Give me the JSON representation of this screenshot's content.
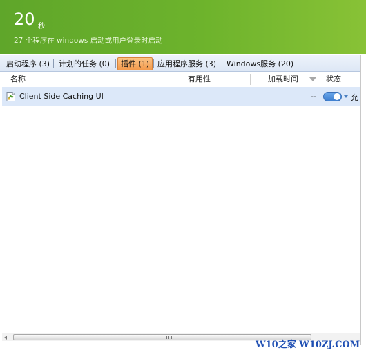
{
  "header": {
    "big_number": "20",
    "unit": "秒",
    "subtitle": "27 个程序在 windows 启动或用户登录时启动"
  },
  "tabs": [
    {
      "label": "启动程序 (3)",
      "active": false
    },
    {
      "label": "计划的任务 (0)",
      "active": false
    },
    {
      "label": "插件 (1)",
      "active": true
    },
    {
      "label": "应用程序服务 (3)",
      "active": false
    },
    {
      "label": "Windows服务 (20)",
      "active": false
    }
  ],
  "columns": {
    "name": "名称",
    "useful": "有用性",
    "load_time": "加载时间",
    "status": "状态"
  },
  "rows": [
    {
      "name": "Client Side Caching UI",
      "useful": "--",
      "status": "允",
      "enabled": true
    }
  ],
  "watermark": "W10之家 W10ZJ.COM",
  "colors": {
    "header_green": "#6db32c",
    "active_tab": "#f39a4c",
    "selected_row": "#dce8f9",
    "toggle_blue": "#3e7fd0"
  }
}
